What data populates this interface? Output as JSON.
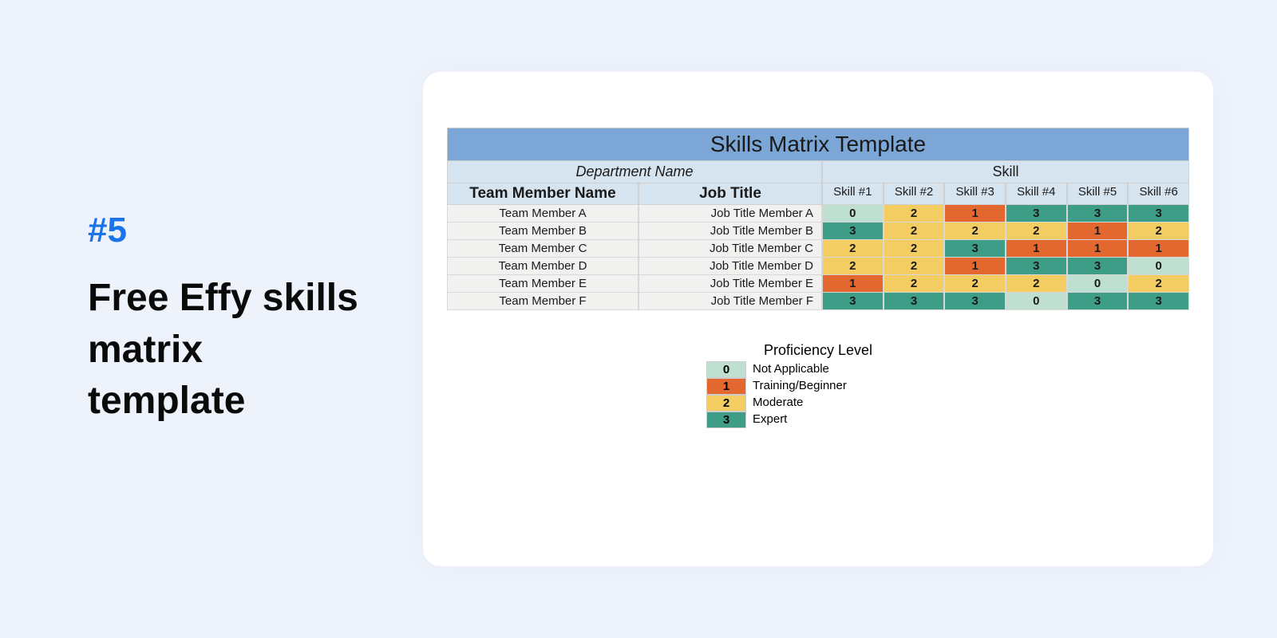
{
  "left": {
    "number": "#5",
    "title": "Free Effy skills matrix template"
  },
  "sheet": {
    "banner": "Skills Matrix Template",
    "dept": "Department Name",
    "skill_hdr": "Skill",
    "team_hdr": "Team Member Name",
    "job_hdr": "Job Title",
    "skill_cols": [
      "Skill #1",
      "Skill #2",
      "Skill #3",
      "Skill #4",
      "Skill #5",
      "Skill #6"
    ],
    "rows": [
      {
        "name": "Team Member A",
        "job": "Job Title Member A",
        "vals": [
          0,
          2,
          1,
          3,
          3,
          3
        ]
      },
      {
        "name": "Team Member B",
        "job": "Job Title Member B",
        "vals": [
          3,
          2,
          2,
          2,
          1,
          2
        ]
      },
      {
        "name": "Team Member C",
        "job": "Job Title Member C",
        "vals": [
          2,
          2,
          3,
          1,
          1,
          1
        ]
      },
      {
        "name": "Team Member D",
        "job": "Job Title Member D",
        "vals": [
          2,
          2,
          1,
          3,
          3,
          0
        ]
      },
      {
        "name": "Team Member E",
        "job": "Job Title Member E",
        "vals": [
          1,
          2,
          2,
          2,
          0,
          2
        ]
      },
      {
        "name": "Team Member F",
        "job": "Job Title Member F",
        "vals": [
          3,
          3,
          3,
          0,
          3,
          3
        ]
      }
    ]
  },
  "legend": {
    "title": "Proficiency Level",
    "items": [
      {
        "value": 0,
        "label": "Not Applicable"
      },
      {
        "value": 1,
        "label": "Training/Beginner"
      },
      {
        "value": 2,
        "label": "Moderate"
      },
      {
        "value": 3,
        "label": "Expert"
      }
    ]
  },
  "chart_data": {
    "type": "table",
    "title": "Skills Matrix Template",
    "columns": [
      "Team Member Name",
      "Job Title",
      "Skill #1",
      "Skill #2",
      "Skill #3",
      "Skill #4",
      "Skill #5",
      "Skill #6"
    ],
    "rows": [
      [
        "Team Member A",
        "Job Title Member A",
        0,
        2,
        1,
        3,
        3,
        3
      ],
      [
        "Team Member B",
        "Job Title Member B",
        3,
        2,
        2,
        2,
        1,
        2
      ],
      [
        "Team Member C",
        "Job Title Member C",
        2,
        2,
        3,
        1,
        1,
        1
      ],
      [
        "Team Member D",
        "Job Title Member D",
        2,
        2,
        1,
        3,
        3,
        0
      ],
      [
        "Team Member E",
        "Job Title Member E",
        1,
        2,
        2,
        2,
        0,
        2
      ],
      [
        "Team Member F",
        "Job Title Member F",
        3,
        3,
        3,
        0,
        3,
        3
      ]
    ],
    "legend": {
      "0": "Not Applicable",
      "1": "Training/Beginner",
      "2": "Moderate",
      "3": "Expert"
    }
  }
}
